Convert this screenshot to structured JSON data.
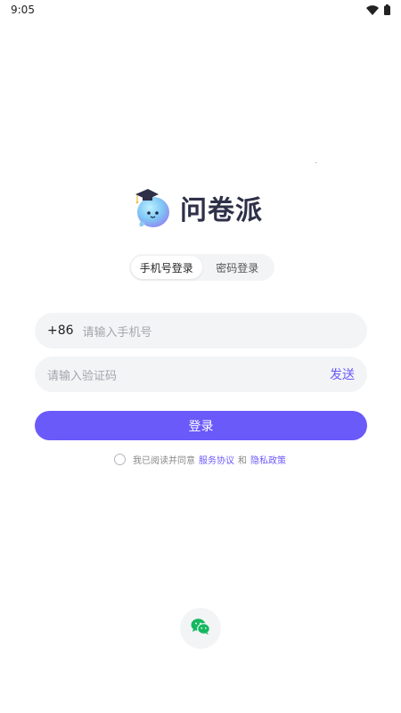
{
  "status_bar": {
    "time": "9:05",
    "icons": [
      "wifi-icon",
      "battery-icon"
    ]
  },
  "brand": {
    "name": "问卷派",
    "logo_icon": "mascot-graduation-cap-icon"
  },
  "tabs": [
    {
      "label": "手机号登录",
      "active": true
    },
    {
      "label": "密码登录",
      "active": false
    }
  ],
  "phone": {
    "prefix": "+86",
    "placeholder": "请输入手机号"
  },
  "code": {
    "placeholder": "请输入验证码",
    "send_label": "发送"
  },
  "login_button": {
    "label": "登录"
  },
  "agreement": {
    "text": "我已阅读并同意",
    "service_link": "服务协议",
    "and": "和",
    "privacy_link": "隐私政策"
  },
  "third_party": {
    "wechat_icon": "wechat-icon"
  },
  "colors": {
    "accent": "#6a5af9",
    "field_bg": "#f3f4f6",
    "brand_text": "#2d3047"
  }
}
